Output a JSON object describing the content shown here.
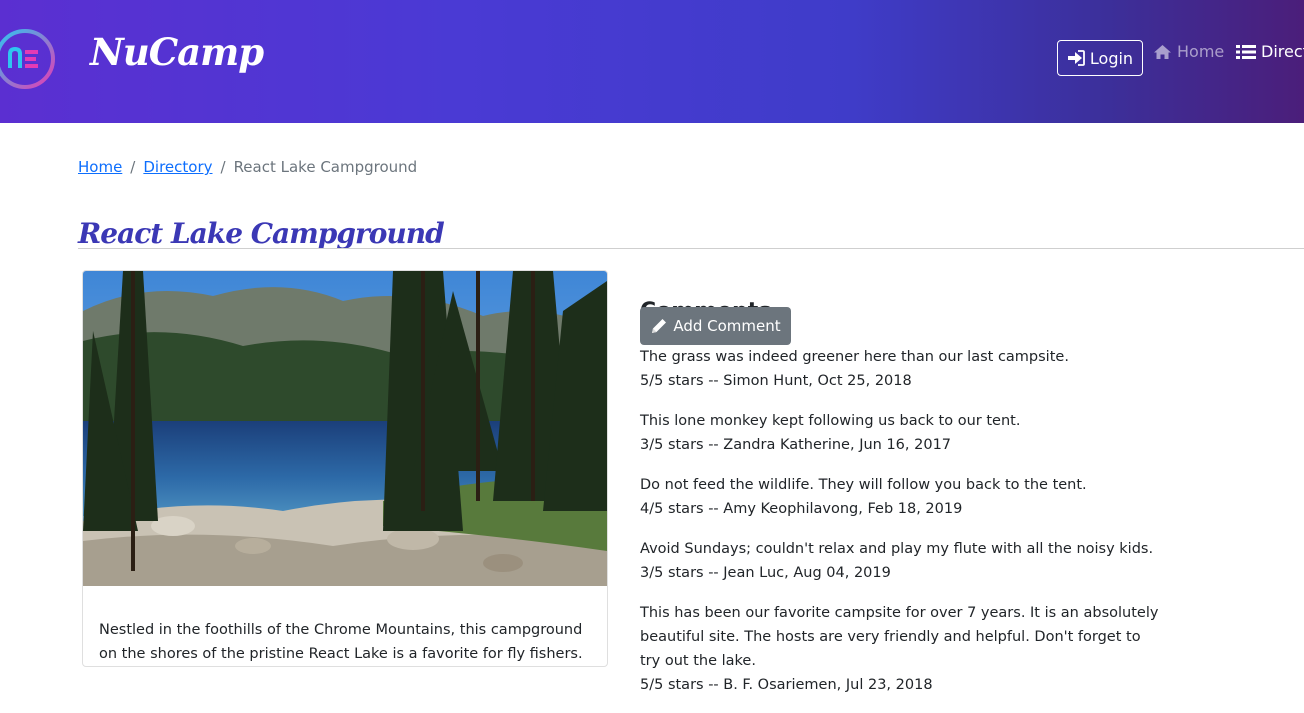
{
  "brand": {
    "name": "NuCamp"
  },
  "nav": {
    "login_label": "Login",
    "home_label": "Home",
    "directory_label": "Direct"
  },
  "breadcrumb": {
    "home": "Home",
    "sep1": "/",
    "directory": "Directory",
    "sep2": "/",
    "current": "React Lake Campground"
  },
  "campsite": {
    "title": "React Lake Campground",
    "description": "Nestled in the foothills of the Chrome Mountains, this campground on the shores of the pristine React Lake is a favorite for fly fishers.",
    "image_icon": "lake-photo"
  },
  "comments": {
    "heading": "Comments",
    "add_label": "Add Comment",
    "items": [
      {
        "text": "The grass was indeed greener here than our last campsite.",
        "meta": "5/5 stars -- Simon Hunt, Oct 25, 2018"
      },
      {
        "text": "This lone monkey kept following us back to our tent.",
        "meta": "3/5 stars -- Zandra Katherine, Jun 16, 2017"
      },
      {
        "text": "Do not feed the wildlife. They will follow you back to the tent.",
        "meta": "4/5 stars -- Amy Keophilavong, Feb 18, 2019"
      },
      {
        "text": "Avoid Sundays; couldn't relax and play my flute with all the noisy kids.",
        "meta": "3/5 stars -- Jean Luc, Aug 04, 2019"
      },
      {
        "text": "This has been our favorite campsite for over 7 years. It is an absolutely beautiful site. The hosts are very friendly and helpful. Don't forget to try out the lake.",
        "meta": "5/5 stars -- B. F. Osariemen, Jul 23, 2018"
      }
    ]
  },
  "colors": {
    "accent": "#3b38b5",
    "link": "#0d6efd",
    "button_secondary": "#6c757d"
  },
  "icons": {
    "logo": "nucamp-logo-icon",
    "login": "sign-in-icon",
    "home": "home-icon",
    "directory": "list-icon",
    "add": "pencil-icon"
  }
}
